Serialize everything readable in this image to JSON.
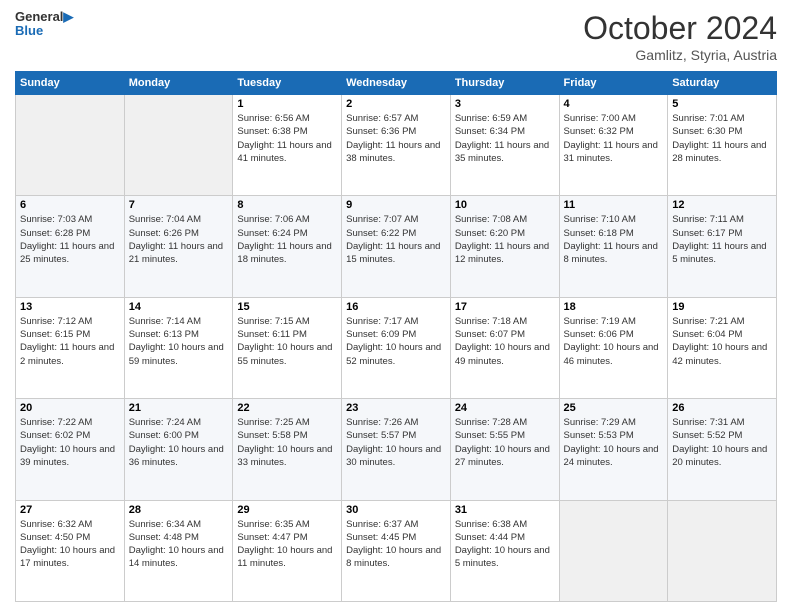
{
  "header": {
    "logo_line1": "General",
    "logo_line2": "Blue",
    "month": "October 2024",
    "location": "Gamlitz, Styria, Austria"
  },
  "days_of_week": [
    "Sunday",
    "Monday",
    "Tuesday",
    "Wednesday",
    "Thursday",
    "Friday",
    "Saturday"
  ],
  "weeks": [
    [
      {
        "day": "",
        "info": ""
      },
      {
        "day": "",
        "info": ""
      },
      {
        "day": "1",
        "info": "Sunrise: 6:56 AM\nSunset: 6:38 PM\nDaylight: 11 hours and 41 minutes."
      },
      {
        "day": "2",
        "info": "Sunrise: 6:57 AM\nSunset: 6:36 PM\nDaylight: 11 hours and 38 minutes."
      },
      {
        "day": "3",
        "info": "Sunrise: 6:59 AM\nSunset: 6:34 PM\nDaylight: 11 hours and 35 minutes."
      },
      {
        "day": "4",
        "info": "Sunrise: 7:00 AM\nSunset: 6:32 PM\nDaylight: 11 hours and 31 minutes."
      },
      {
        "day": "5",
        "info": "Sunrise: 7:01 AM\nSunset: 6:30 PM\nDaylight: 11 hours and 28 minutes."
      }
    ],
    [
      {
        "day": "6",
        "info": "Sunrise: 7:03 AM\nSunset: 6:28 PM\nDaylight: 11 hours and 25 minutes."
      },
      {
        "day": "7",
        "info": "Sunrise: 7:04 AM\nSunset: 6:26 PM\nDaylight: 11 hours and 21 minutes."
      },
      {
        "day": "8",
        "info": "Sunrise: 7:06 AM\nSunset: 6:24 PM\nDaylight: 11 hours and 18 minutes."
      },
      {
        "day": "9",
        "info": "Sunrise: 7:07 AM\nSunset: 6:22 PM\nDaylight: 11 hours and 15 minutes."
      },
      {
        "day": "10",
        "info": "Sunrise: 7:08 AM\nSunset: 6:20 PM\nDaylight: 11 hours and 12 minutes."
      },
      {
        "day": "11",
        "info": "Sunrise: 7:10 AM\nSunset: 6:18 PM\nDaylight: 11 hours and 8 minutes."
      },
      {
        "day": "12",
        "info": "Sunrise: 7:11 AM\nSunset: 6:17 PM\nDaylight: 11 hours and 5 minutes."
      }
    ],
    [
      {
        "day": "13",
        "info": "Sunrise: 7:12 AM\nSunset: 6:15 PM\nDaylight: 11 hours and 2 minutes."
      },
      {
        "day": "14",
        "info": "Sunrise: 7:14 AM\nSunset: 6:13 PM\nDaylight: 10 hours and 59 minutes."
      },
      {
        "day": "15",
        "info": "Sunrise: 7:15 AM\nSunset: 6:11 PM\nDaylight: 10 hours and 55 minutes."
      },
      {
        "day": "16",
        "info": "Sunrise: 7:17 AM\nSunset: 6:09 PM\nDaylight: 10 hours and 52 minutes."
      },
      {
        "day": "17",
        "info": "Sunrise: 7:18 AM\nSunset: 6:07 PM\nDaylight: 10 hours and 49 minutes."
      },
      {
        "day": "18",
        "info": "Sunrise: 7:19 AM\nSunset: 6:06 PM\nDaylight: 10 hours and 46 minutes."
      },
      {
        "day": "19",
        "info": "Sunrise: 7:21 AM\nSunset: 6:04 PM\nDaylight: 10 hours and 42 minutes."
      }
    ],
    [
      {
        "day": "20",
        "info": "Sunrise: 7:22 AM\nSunset: 6:02 PM\nDaylight: 10 hours and 39 minutes."
      },
      {
        "day": "21",
        "info": "Sunrise: 7:24 AM\nSunset: 6:00 PM\nDaylight: 10 hours and 36 minutes."
      },
      {
        "day": "22",
        "info": "Sunrise: 7:25 AM\nSunset: 5:58 PM\nDaylight: 10 hours and 33 minutes."
      },
      {
        "day": "23",
        "info": "Sunrise: 7:26 AM\nSunset: 5:57 PM\nDaylight: 10 hours and 30 minutes."
      },
      {
        "day": "24",
        "info": "Sunrise: 7:28 AM\nSunset: 5:55 PM\nDaylight: 10 hours and 27 minutes."
      },
      {
        "day": "25",
        "info": "Sunrise: 7:29 AM\nSunset: 5:53 PM\nDaylight: 10 hours and 24 minutes."
      },
      {
        "day": "26",
        "info": "Sunrise: 7:31 AM\nSunset: 5:52 PM\nDaylight: 10 hours and 20 minutes."
      }
    ],
    [
      {
        "day": "27",
        "info": "Sunrise: 6:32 AM\nSunset: 4:50 PM\nDaylight: 10 hours and 17 minutes."
      },
      {
        "day": "28",
        "info": "Sunrise: 6:34 AM\nSunset: 4:48 PM\nDaylight: 10 hours and 14 minutes."
      },
      {
        "day": "29",
        "info": "Sunrise: 6:35 AM\nSunset: 4:47 PM\nDaylight: 10 hours and 11 minutes."
      },
      {
        "day": "30",
        "info": "Sunrise: 6:37 AM\nSunset: 4:45 PM\nDaylight: 10 hours and 8 minutes."
      },
      {
        "day": "31",
        "info": "Sunrise: 6:38 AM\nSunset: 4:44 PM\nDaylight: 10 hours and 5 minutes."
      },
      {
        "day": "",
        "info": ""
      },
      {
        "day": "",
        "info": ""
      }
    ]
  ]
}
